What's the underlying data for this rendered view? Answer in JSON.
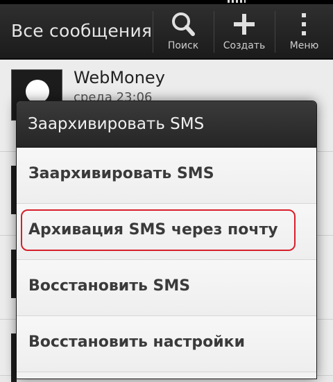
{
  "actionbar": {
    "title": "Все сообщения",
    "actions": [
      {
        "label": "Поиск",
        "icon": "search-icon"
      },
      {
        "label": "Создать",
        "icon": "plus-icon"
      },
      {
        "label": "Меню",
        "icon": "overflow-menu-icon"
      }
    ]
  },
  "conversations": [
    {
      "name": "WebMoney",
      "time": "среда 23:06"
    }
  ],
  "dialog": {
    "title": "Заархивировать SMS",
    "items": [
      {
        "label": "Заархивировать SMS"
      },
      {
        "label": "Архивация SMS через почту",
        "highlighted": true
      },
      {
        "label": "Восстановить SMS"
      },
      {
        "label": "Восстановить настройки"
      }
    ],
    "highlight_color": "#d81e2a"
  }
}
